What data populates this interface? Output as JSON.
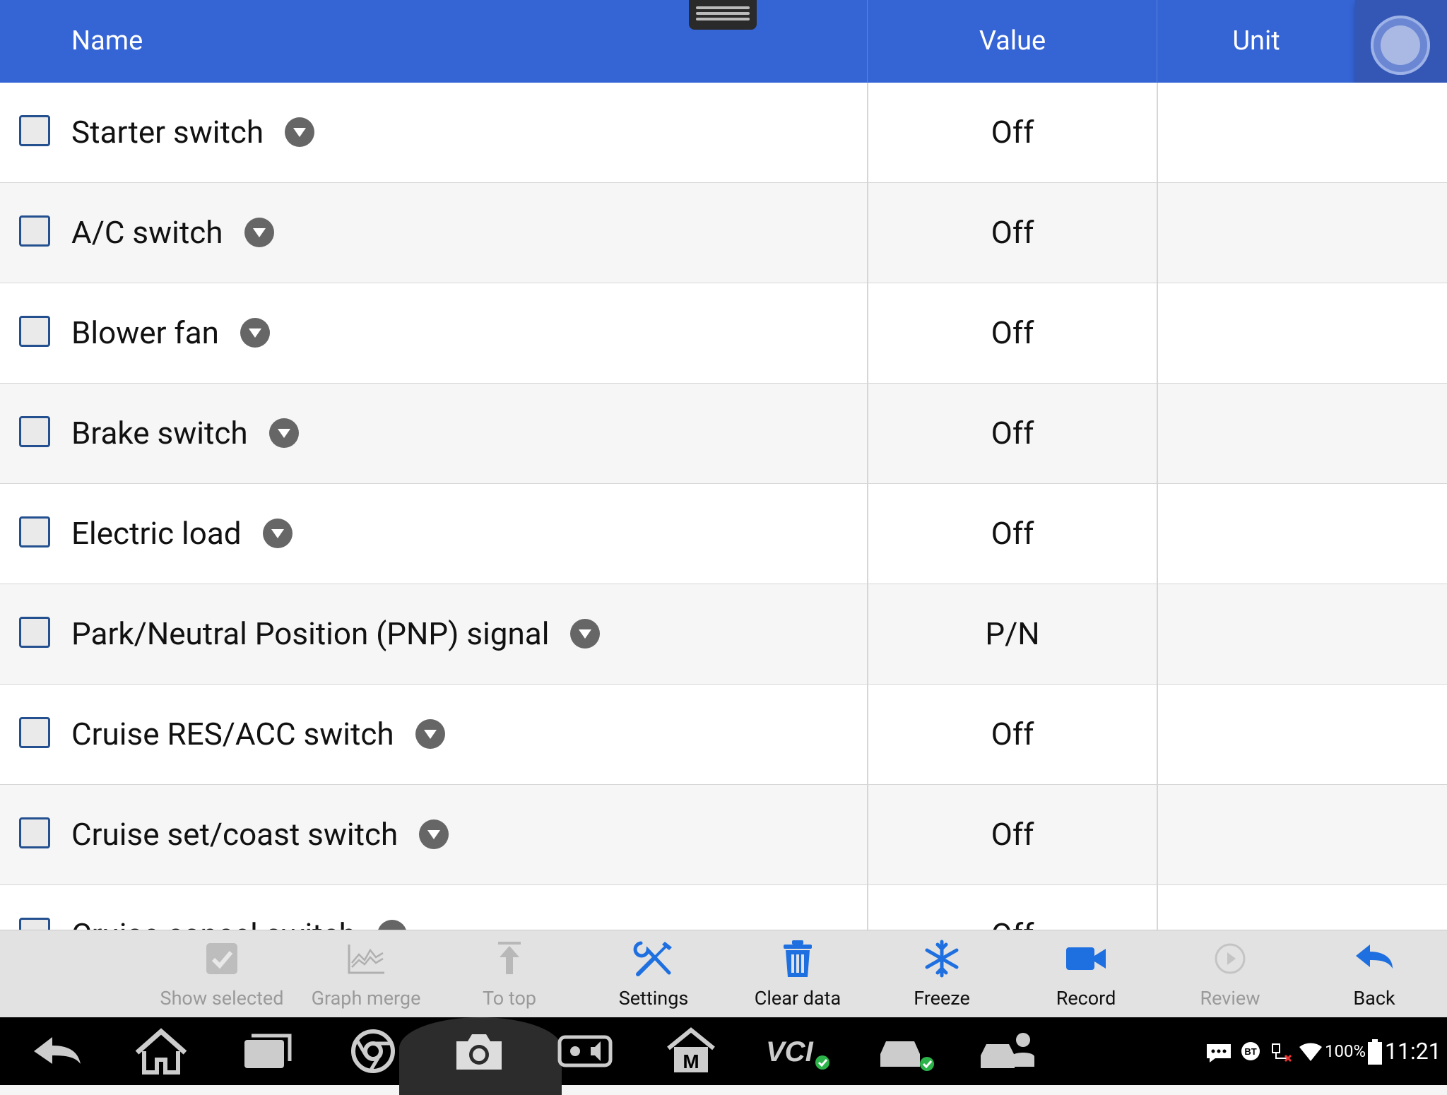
{
  "header": {
    "name": "Name",
    "value": "Value",
    "unit": "Unit"
  },
  "rows": [
    {
      "name": "Starter switch",
      "value": "Off",
      "unit": ""
    },
    {
      "name": "A/C switch",
      "value": "Off",
      "unit": ""
    },
    {
      "name": "Blower fan",
      "value": "Off",
      "unit": ""
    },
    {
      "name": "Brake switch",
      "value": "Off",
      "unit": ""
    },
    {
      "name": "Electric load",
      "value": "Off",
      "unit": ""
    },
    {
      "name": "Park/Neutral Position (PNP) signal",
      "value": "P/N",
      "unit": ""
    },
    {
      "name": "Cruise RES/ACC switch",
      "value": "Off",
      "unit": ""
    },
    {
      "name": "Cruise set/coast switch",
      "value": "Off",
      "unit": ""
    },
    {
      "name": "Cruise cancel switch",
      "value": "Off",
      "unit": ""
    }
  ],
  "toolbar": {
    "show_selected": "Show selected",
    "graph_merge": "Graph merge",
    "to_top": "To top",
    "settings": "Settings",
    "clear_data": "Clear data",
    "freeze": "Freeze",
    "record": "Record",
    "review": "Review",
    "back": "Back"
  },
  "status": {
    "battery": "100%",
    "time": "11:21",
    "bt": "BT"
  },
  "colors": {
    "header": "#3564d4",
    "accent": "#1e6fe0",
    "disabled": "#9a9a9a"
  }
}
